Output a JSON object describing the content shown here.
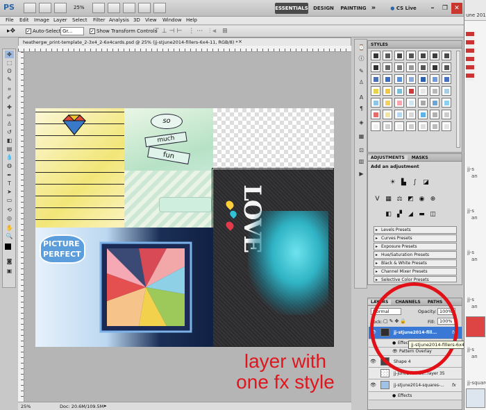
{
  "app": {
    "logo": "PS",
    "zoom": "25%"
  },
  "workspace": {
    "essentials": "ESSENTIALS",
    "design": "DESIGN",
    "painting": "PAINTING",
    "more": "»",
    "cslive": "CS Live"
  },
  "menu": [
    "File",
    "Edit",
    "Image",
    "Layer",
    "Select",
    "Filter",
    "Analysis",
    "3D",
    "View",
    "Window",
    "Help"
  ],
  "options": {
    "auto_select_label": "Auto-Select:",
    "auto_select_value": "Gr...",
    "transform_label": "Show Transform Controls"
  },
  "document": {
    "tab_title": "heathergw_print-template_2-3x4_2-6x4cards.psd @ 25% (jj-stjune2014-fillers-6x4-11, RGB/8) *",
    "zoom": "25%",
    "doc_size": "Doc: 20.6M/109.5M",
    "card_texts": {
      "so": "so",
      "much": "much",
      "fun": "fun",
      "picture": "PICTURE",
      "perfect": "PERFECT",
      "love": "LOVE"
    }
  },
  "styles_panel": {
    "title": "STYLES",
    "swatches": [
      "#333333",
      "#5a5a5a",
      "#444444",
      "#555555",
      "#444444",
      "#3d3d3d",
      "#4a4a4a",
      "#2f2f2f",
      "#666666",
      "#777777",
      "#999999",
      "#555555",
      "#333333",
      "#555555",
      "#4a6fb5",
      "#3a6bc7",
      "#5b8fd6",
      "#8aa9dd",
      "#2e5fb0",
      "#6b9ce0",
      "#476fc0",
      "#e7d34a",
      "#f1c93c",
      "#7fbcd6",
      "#d23a3a",
      "#e6e6e6",
      "#b8b8b8",
      "#a9cde3",
      "#8ec4e6",
      "#f2d15c",
      "#f7a6b1",
      "#cfe6f5",
      "#a8a8a8",
      "#6ba6d6",
      "#8bd0f0",
      "#e86b6b",
      "#f3e4a0",
      "#b5d8ef",
      "#d8d8d8",
      "#5db2e6",
      "#b0b0b0",
      "#cccccc",
      "#f0f0f0",
      "#d0d0d0",
      "#eeeeee",
      "#cccccc",
      "#dddddd",
      "#bbbbbb",
      "#e4e4e4"
    ]
  },
  "adjustments_panel": {
    "tabs": [
      "ADJUSTMENTS",
      "MASKS"
    ],
    "subtitle": "Add an adjustment",
    "presets": [
      "Levels Presets",
      "Curves Presets",
      "Exposure Presets",
      "Hue/Saturation Presets",
      "Black & White Presets",
      "Channel Mixer Presets",
      "Selective Color Presets"
    ]
  },
  "layers_panel": {
    "tabs": [
      "LAYERS",
      "CHANNELS",
      "PATHS"
    ],
    "blend_mode": "Normal",
    "opacity_label": "Opacity:",
    "opacity_value": "100%",
    "lock_label": "Lock:",
    "fill_label": "Fill:",
    "fill_value": "100%",
    "layers": [
      {
        "name": "jj-stjune2014-fill...",
        "fx": "fx",
        "selected": true
      },
      {
        "name": "Effects",
        "sub": true
      },
      {
        "name": "Pattern Overlay",
        "sub": true
      },
      {
        "name": "Shape 4"
      },
      {
        "name": "jj-june2014-do...layer 35"
      },
      {
        "name": "jj-stjune2014-squares-...",
        "fx": "fx"
      },
      {
        "name": "Effects",
        "sub": true
      }
    ],
    "tooltip": "jj-stjune2014-fillers-6x4-11"
  },
  "background_window": {
    "texts": [
      "une 2014",
      "jj-s",
      "an",
      "jj-s",
      "an",
      "jj-s",
      "an",
      "jj-s",
      "an",
      "jj-s",
      "an",
      "jj-square"
    ]
  },
  "annotation": {
    "line1": "layer with",
    "line2": "one fx style"
  },
  "colors": {
    "accent_red": "#e21117",
    "selected_layer": "#3a78d6",
    "canvas_bg": "#b5b5b5"
  }
}
